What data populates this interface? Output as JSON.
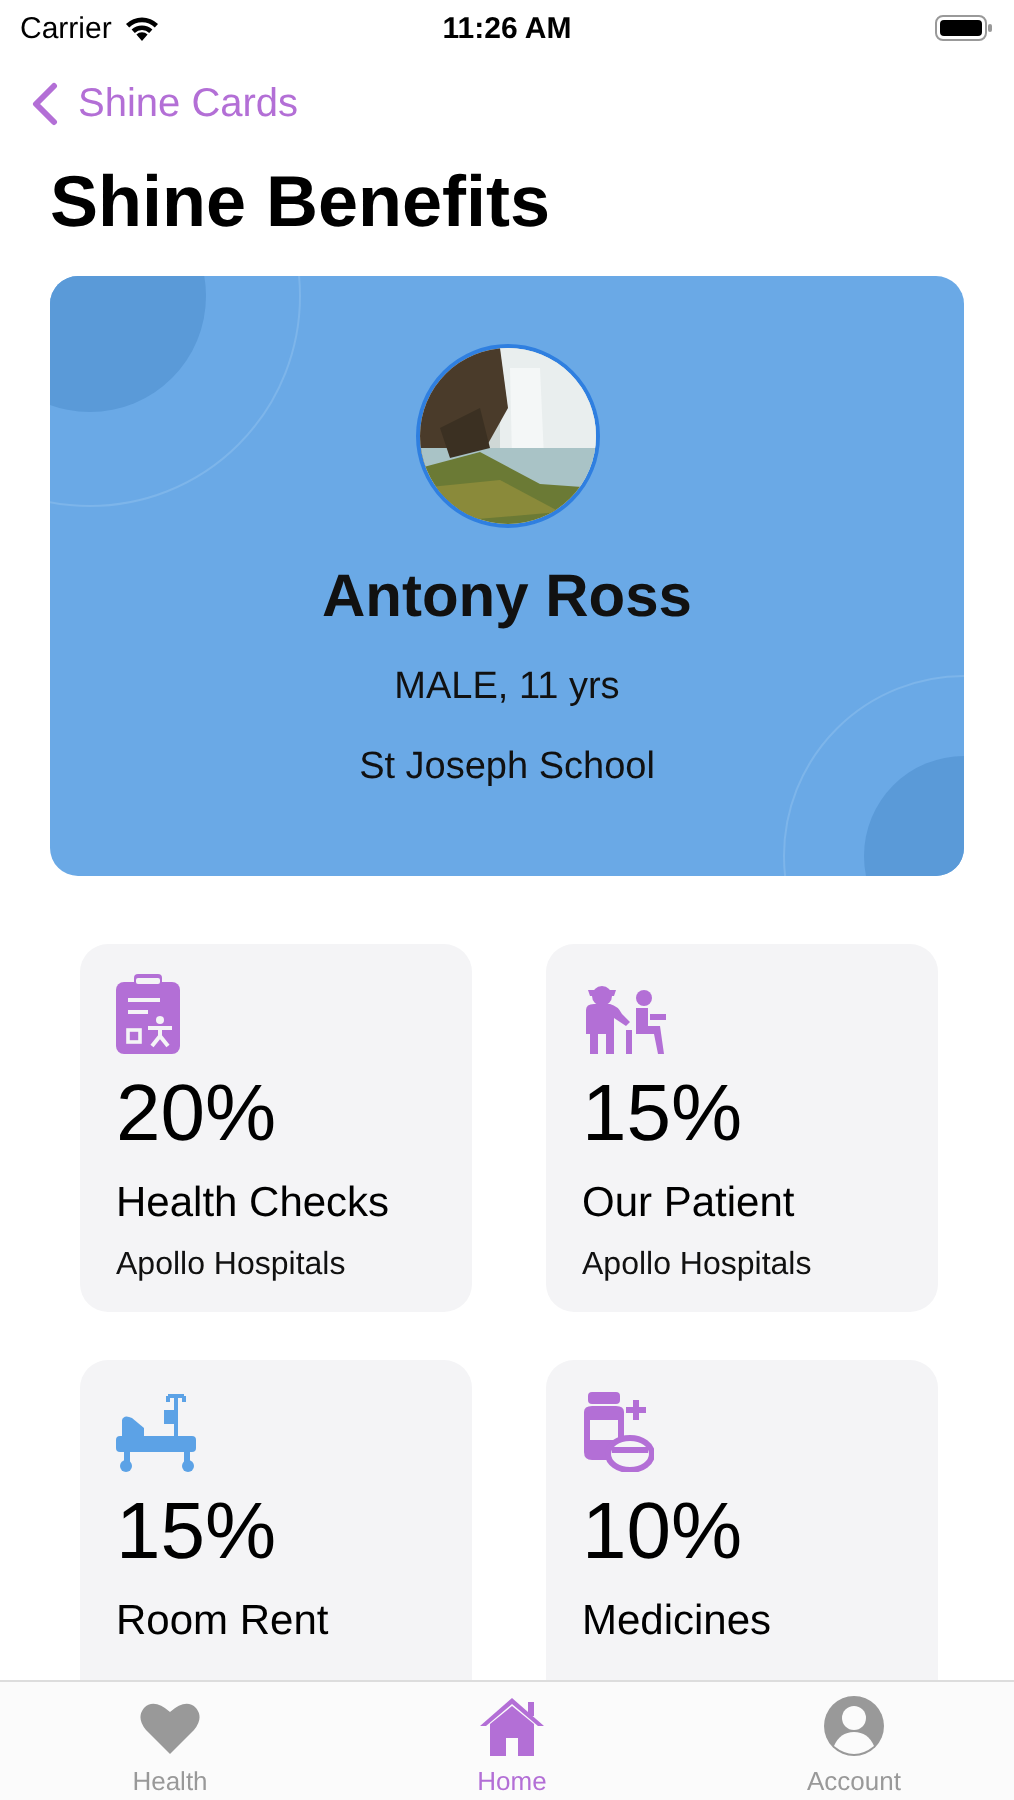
{
  "status_bar": {
    "carrier": "Carrier",
    "time": "11:26 AM"
  },
  "nav": {
    "back": "Shine Cards",
    "title": "Shine Benefits"
  },
  "profile": {
    "name": "Antony Ross",
    "details": "MALE, 11 yrs",
    "school": "St Joseph School"
  },
  "benefits": [
    {
      "percent": "20%",
      "title": "Health Checks",
      "provider": "Apollo Hospitals",
      "color": "#b36fd6"
    },
    {
      "percent": "15%",
      "title": "Our Patient",
      "provider": "Apollo Hospitals",
      "color": "#b36fd6"
    },
    {
      "percent": "15%",
      "title": "Room Rent",
      "color": "#5ca2e6"
    },
    {
      "percent": "10%",
      "title": "Medicines",
      "color": "#b36fd6"
    }
  ],
  "tab_bar": [
    {
      "label": "Health",
      "selected": false
    },
    {
      "label": "Home",
      "selected": true
    },
    {
      "label": "Account",
      "selected": false
    }
  ]
}
